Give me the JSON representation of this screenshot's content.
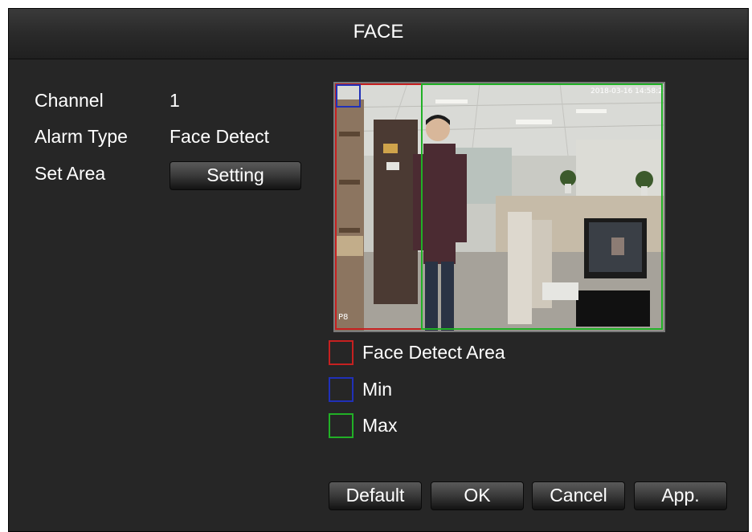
{
  "dialog": {
    "title": "FACE"
  },
  "fields": {
    "channel_label": "Channel",
    "channel_value": "1",
    "alarm_type_label": "Alarm Type",
    "alarm_type_value": "Face Detect",
    "set_area_label": "Set Area",
    "setting_button": "Setting"
  },
  "preview": {
    "timestamp": "2018-03-16 14:58:22",
    "camera_id": "P8"
  },
  "legend": [
    {
      "label": "Face Detect Area",
      "color": "#c62020"
    },
    {
      "label": "Min",
      "color": "#2030b8"
    },
    {
      "label": "Max",
      "color": "#21b026"
    }
  ],
  "buttons": {
    "default": "Default",
    "ok": "OK",
    "cancel": "Cancel",
    "apply": "App."
  }
}
